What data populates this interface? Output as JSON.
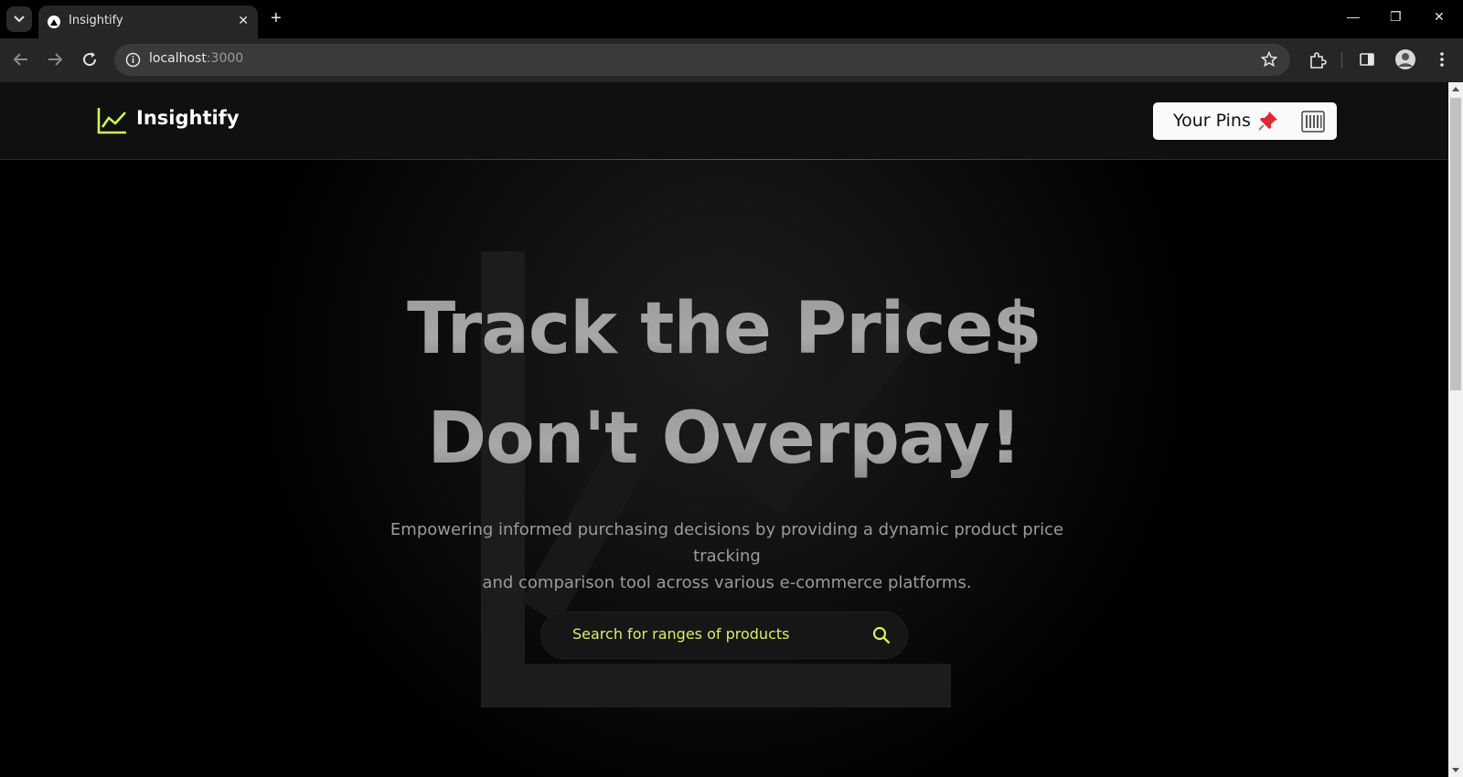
{
  "browser": {
    "tab_title": "Insightify",
    "url_host": "localhost",
    "url_port": ":3000"
  },
  "navbar": {
    "brand": "Insightify",
    "pins_label": "Your Pins",
    "pins_emoji": "📌",
    "accent": "#d4f25a"
  },
  "hero": {
    "title_line1": "Track the Price$",
    "title_line2": "Don't Overpay!",
    "subtitle_line1": "Empowering informed purchasing decisions by providing a dynamic product price tracking",
    "subtitle_line2": "and comparison tool across various e-commerce platforms."
  },
  "search": {
    "placeholder": "Search for ranges of products"
  }
}
